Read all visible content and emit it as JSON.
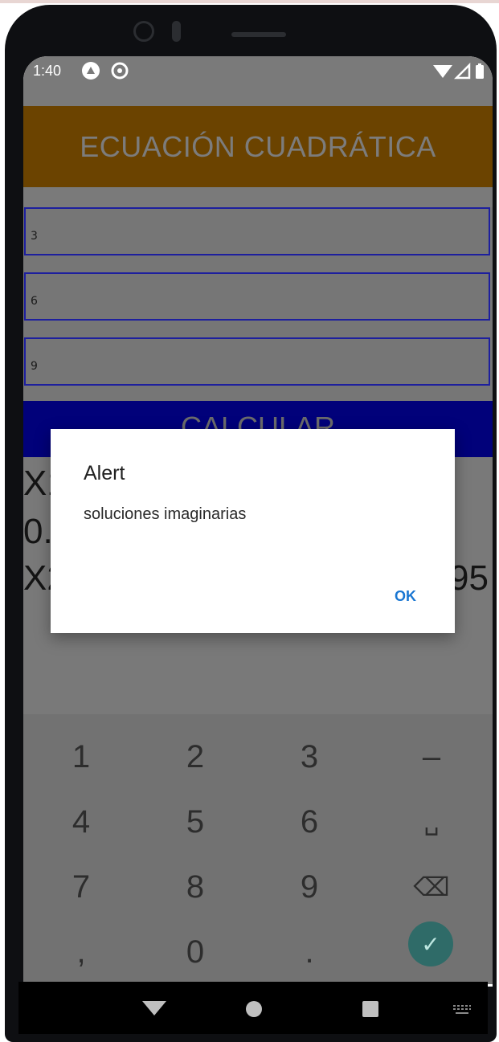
{
  "status_bar": {
    "time": "1:40",
    "icons": [
      "a-circle-icon",
      "at-circle-icon",
      "wifi-icon",
      "signal-icon",
      "battery-icon"
    ]
  },
  "app": {
    "title": "ECUACIÓN CUADRÁTICA",
    "inputs": [
      {
        "value": "3"
      },
      {
        "value": "6"
      },
      {
        "value": "9"
      }
    ],
    "calculate_label": "CALCULAR",
    "results": {
      "x1_visible_prefix": "X1",
      "value_visible_prefix": "0.",
      "x2_visible_prefix": "X2",
      "x2_visible_suffix": "95"
    }
  },
  "dialog": {
    "title": "Alert",
    "message": "soluciones imaginarias",
    "ok_label": "OK"
  },
  "keyboard": {
    "rows": [
      [
        "1",
        "2",
        "3",
        "–"
      ],
      [
        "4",
        "5",
        "6",
        "␣"
      ],
      [
        "7",
        "8",
        "9",
        "⌫"
      ],
      [
        ",",
        "0",
        ".",
        "✓"
      ]
    ]
  },
  "colors": {
    "header_bg": "#6b4300",
    "calc_bg": "#01017a",
    "input_border": "#1d1f9e",
    "dialog_button": "#1976d2",
    "keyboard_ok": "#2f6b68"
  }
}
